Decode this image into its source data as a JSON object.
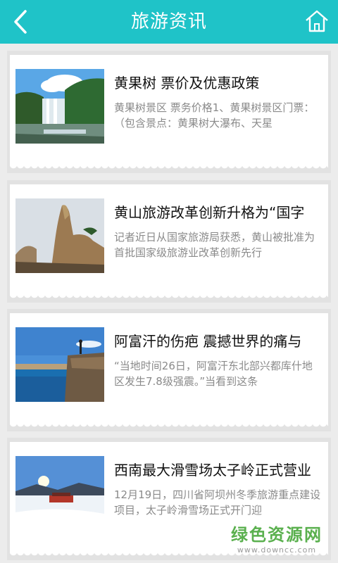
{
  "header": {
    "title": "旅游资讯",
    "back_icon": "chevron-left-icon",
    "home_icon": "home-icon",
    "color": "#1fc3c8"
  },
  "articles": [
    {
      "title": "黄果树 票价及优惠政策",
      "desc": "黄果树景区 票务价格1、黄果树景区门票：（包含景点：黄果树大瀑布、天星",
      "image": "waterfall"
    },
    {
      "title": "黄山旅游改革创新升格为“国字",
      "desc": "记者近日从国家旅游局获悉，黄山被批准为首批国家级旅游业改革创新先行",
      "image": "mountain-peak"
    },
    {
      "title": "阿富汗的伤疤 震撼世界的痛与",
      "desc": "“当地时间26日，阿富汗东北部兴都库什地区发生7.8级强震。”当看到这条",
      "image": "cliff-lake"
    },
    {
      "title": "西南最大滑雪场太子岭正式营业",
      "desc": "12月19日，四川省阿坝州冬季旅游重点建设项目，太子岭滑雪场正式开门迎",
      "image": "ski-resort"
    }
  ],
  "watermark": {
    "main": "绿色资源网",
    "sub": "www.downcc.com"
  }
}
